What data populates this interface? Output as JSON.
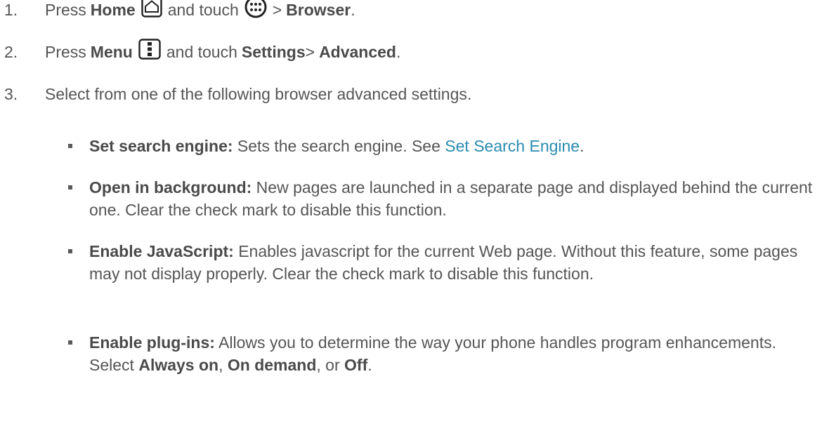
{
  "steps": [
    {
      "num": "1.",
      "a": "Press ",
      "b": "Home",
      "c": " and touch ",
      "d": " > ",
      "e": "Browser",
      "f": "."
    },
    {
      "num": "2.",
      "a": "Press ",
      "b": "Menu",
      "c": " and touch ",
      "d": "Settings",
      "e": " > ",
      "f": "Advanced",
      "g": "."
    },
    {
      "num": "3.",
      "text": "Select from one of the following browser advanced settings."
    }
  ],
  "bullets": [
    {
      "term": "Set search engine:",
      "text": " Sets the search engine. See ",
      "link": "Set Search Engine",
      "end": "."
    },
    {
      "term": "Open in background:",
      "text": " New pages are launched in a separate page and displayed behind the current one. Clear the check mark to disable this function."
    },
    {
      "term": "Enable JavaScript:",
      "text": " Enables javascript for the current Web page. Without this feature, some pages may not display properly. Clear the check mark to disable this function."
    },
    {
      "term": "Enable plug-ins:",
      "text": " Allows you to determine the way your phone handles program enhancements. Select ",
      "opt1": "Always on",
      "sep1": ", ",
      "opt2": "On demand",
      "sep2": ", or ",
      "opt3": "Off",
      "end": "."
    }
  ],
  "icons": {
    "home": "home-icon",
    "apps": "apps-icon",
    "menu": "menu-icon"
  },
  "colors": {
    "text": "#555555",
    "link": "#2a8bb0"
  }
}
